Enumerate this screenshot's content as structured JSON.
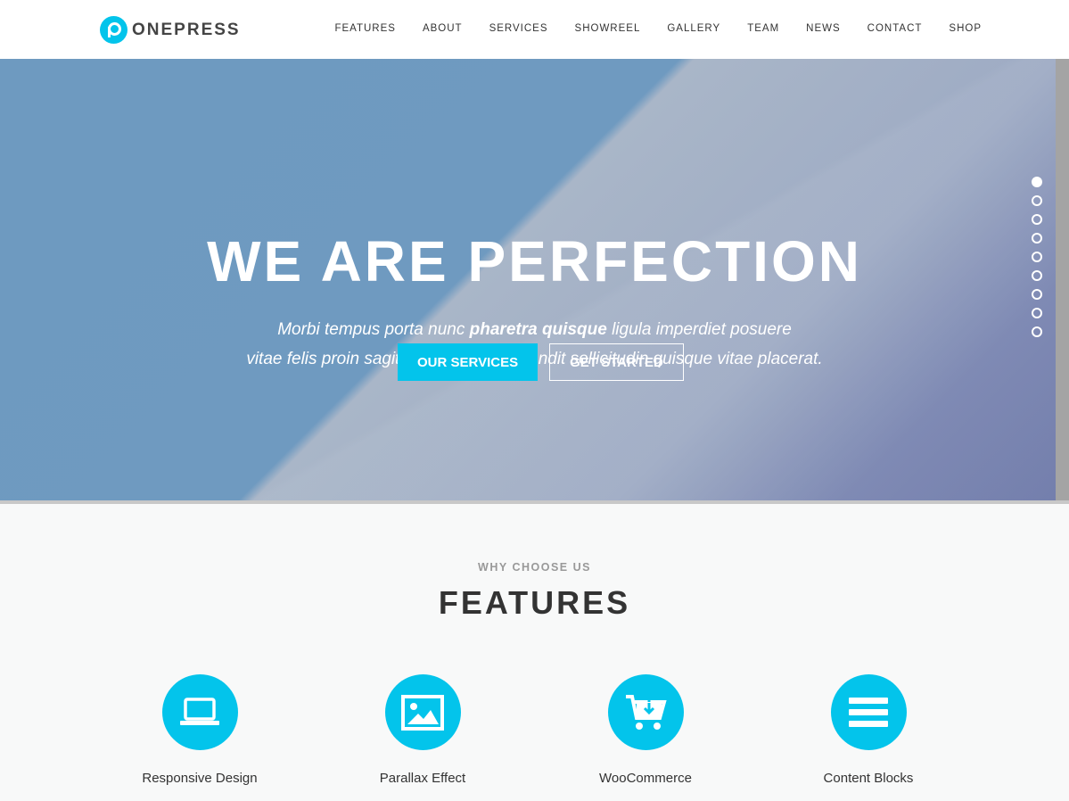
{
  "header": {
    "logo": "ONEPRESS",
    "nav": [
      "FEATURES",
      "ABOUT",
      "SERVICES",
      "SHOWREEL",
      "GALLERY",
      "TEAM",
      "NEWS",
      "CONTACT",
      "SHOP"
    ]
  },
  "hero": {
    "title": "WE ARE PERFECTION",
    "line1_pre": "Morbi tempus porta nunc ",
    "line1_bold": "pharetra quisque",
    "line1_post": " ligula imperdiet posuere",
    "line2": "vitae felis proin sagittis leo ac tellus blandit sollicitudin quisque vitae placerat.",
    "button_primary": "OUR SERVICES",
    "button_secondary": "GET STARTED",
    "slides": 9,
    "active_slide": 1
  },
  "features": {
    "subtitle": "WHY CHOOSE US",
    "title": "FEATURES",
    "items": [
      {
        "title": "Responsive Design",
        "icon": "laptop-icon"
      },
      {
        "title": "Parallax Effect",
        "icon": "image-icon"
      },
      {
        "title": "WooCommerce",
        "icon": "cart-icon"
      },
      {
        "title": "Content Blocks",
        "icon": "bars-icon"
      }
    ]
  },
  "accent": "#03c4eb"
}
